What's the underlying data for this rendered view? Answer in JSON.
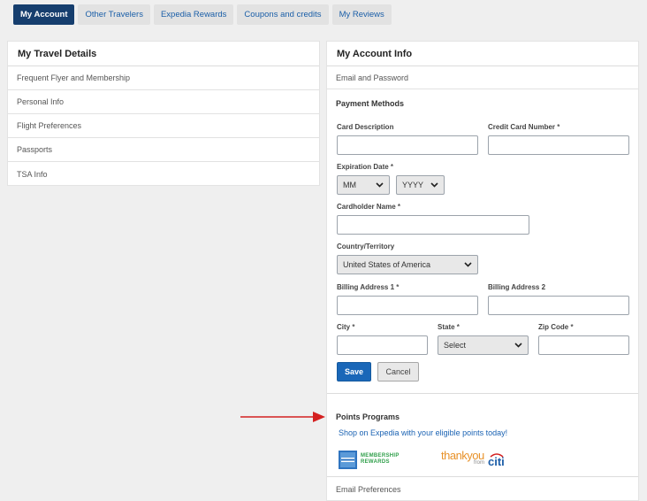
{
  "tabs": [
    {
      "label": "My Account",
      "active": true
    },
    {
      "label": "Other Travelers",
      "active": false
    },
    {
      "label": "Expedia Rewards",
      "active": false
    },
    {
      "label": "Coupons and credits",
      "active": false
    },
    {
      "label": "My Reviews",
      "active": false
    }
  ],
  "travel_details": {
    "title": "My Travel Details",
    "items": [
      "Frequent Flyer and Membership",
      "Personal Info",
      "Flight Preferences",
      "Passports",
      "TSA Info"
    ]
  },
  "account_info": {
    "title": "My Account Info",
    "email_password": "Email and Password",
    "payment": {
      "title": "Payment Methods",
      "card_description_label": "Card Description",
      "card_number_label": "Credit Card Number",
      "expiration_label": "Expiration Date",
      "month_value": "MM",
      "year_value": "YYYY",
      "cardholder_label": "Cardholder Name",
      "country_label": "Country/Territory",
      "country_value": "United States of America",
      "address1_label": "Billing Address 1",
      "address2_label": "Billing Address 2",
      "city_label": "City",
      "state_label": "State",
      "state_value": "Select",
      "zip_label": "Zip Code",
      "required_mark": "*",
      "save_label": "Save",
      "cancel_label": "Cancel"
    },
    "points": {
      "title": "Points Programs",
      "link": "Shop on Expedia with your eligible points today!",
      "amex_line1": "MEMBERSHIP",
      "amex_line2": "REWARDS",
      "thankyou_text": "thankyou",
      "thankyou_from": "from",
      "citi_text": "citi"
    },
    "email_preferences": "Email Preferences"
  },
  "colors": {
    "active_tab": "#163e6e",
    "link": "#1b63b3",
    "save_button": "#1a67b8",
    "annotation_arrow": "#d42020"
  }
}
